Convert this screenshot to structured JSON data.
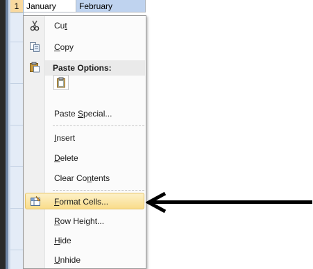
{
  "sheet": {
    "row_number": "1",
    "cell_a1": "January",
    "cell_b1": "February"
  },
  "context_menu": {
    "items": [
      {
        "id": "cut",
        "pre": "Cu",
        "key": "t",
        "post": "",
        "icon": "scissors-icon"
      },
      {
        "id": "copy",
        "pre": "",
        "key": "C",
        "post": "opy",
        "icon": "copy-icon"
      },
      {
        "id": "paste_special",
        "pre": "Paste ",
        "key": "S",
        "post": "pecial...",
        "icon": ""
      },
      {
        "id": "insert",
        "pre": "",
        "key": "I",
        "post": "nsert",
        "icon": ""
      },
      {
        "id": "delete",
        "pre": "",
        "key": "D",
        "post": "elete",
        "icon": ""
      },
      {
        "id": "clear_contents",
        "pre": "Clear Co",
        "key": "n",
        "post": "tents",
        "icon": ""
      },
      {
        "id": "format_cells",
        "pre": "",
        "key": "F",
        "post": "ormat Cells...",
        "icon": "format-cells-icon"
      },
      {
        "id": "row_height",
        "pre": "",
        "key": "R",
        "post": "ow Height...",
        "icon": ""
      },
      {
        "id": "hide",
        "pre": "",
        "key": "H",
        "post": "ide",
        "icon": ""
      },
      {
        "id": "unhide",
        "pre": "",
        "key": "U",
        "post": "nhide",
        "icon": ""
      }
    ],
    "paste_options_label": "Paste Options:",
    "highlighted_item": "format_cells"
  },
  "colors": {
    "highlight": "#f9dc8a",
    "selected_cell": "#bfd3ef",
    "row_header_selected": "#f9d99f"
  }
}
